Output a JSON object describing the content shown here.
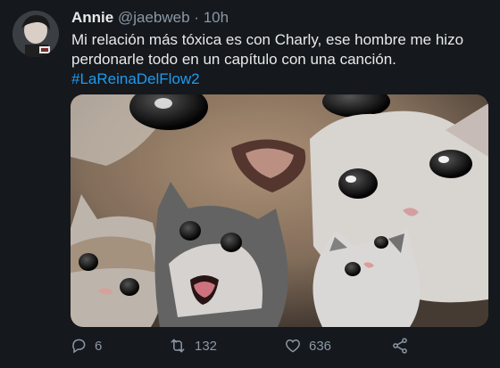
{
  "tweet": {
    "author_name": "Annie",
    "handle": "@jaebweb",
    "separator": "·",
    "time": "10h",
    "text": "Mi relación más tóxica es con Charly, ese hombre me hizo perdonarle todo en un capítulo con una canción.",
    "hashtag": "#LaReinaDelFlow2"
  },
  "actions": {
    "replies": "6",
    "retweets": "132",
    "likes": "636"
  },
  "icons": {
    "reply": "reply-icon",
    "retweet": "retweet-icon",
    "like": "heart-icon",
    "share": "share-icon"
  },
  "colors": {
    "background": "#15181c",
    "text": "#e7e9ea",
    "muted": "#8b98a5",
    "link": "#1d9bf0"
  }
}
